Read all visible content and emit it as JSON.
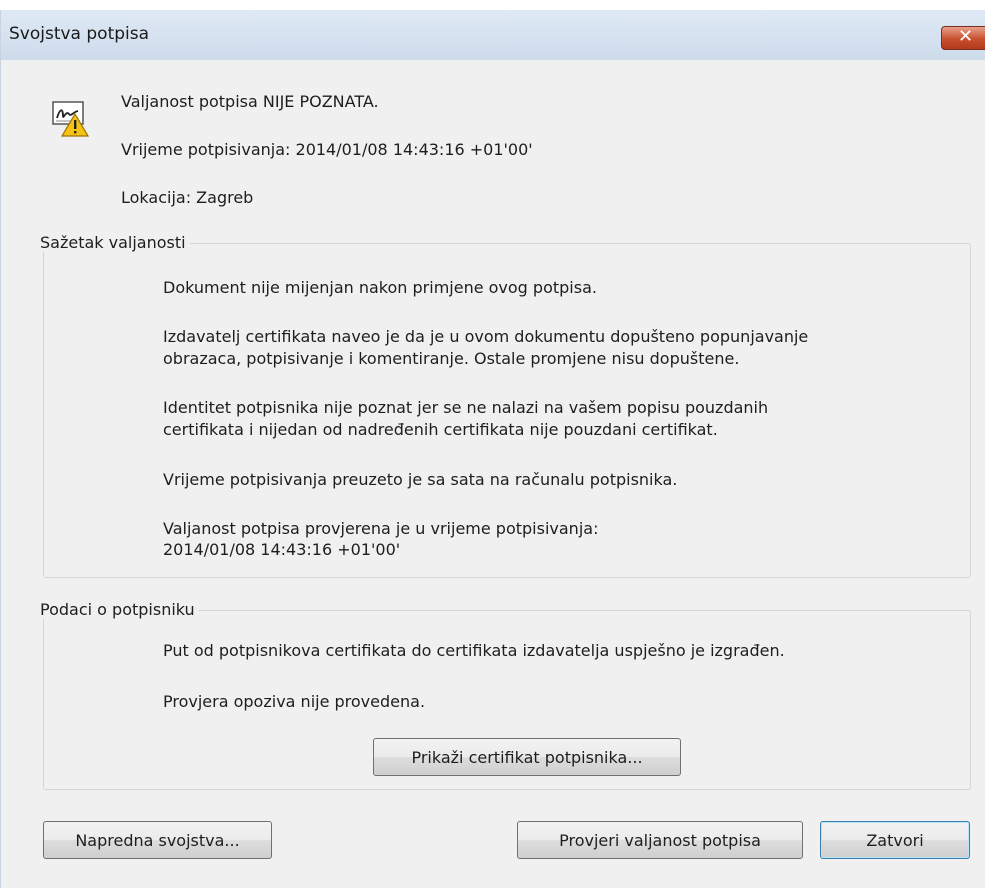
{
  "window": {
    "title": "Svojstva potpisa",
    "close_icon": "close-icon"
  },
  "header": {
    "icon": "signature-warning-icon",
    "status": "Valjanost potpisa NIJE POZNATA.",
    "signing_time": "Vrijeme potpisivanja:  2014/01/08 14:43:16 +01'00'",
    "location": "Lokacija:  Zagreb"
  },
  "validity_summary": {
    "label": "Sažetak valjanosti",
    "lines": [
      "Dokument nije mijenjan nakon primjene ovog potpisa.",
      "Izdavatelj certifikata naveo je da je u ovom dokumentu dopušteno popunjavanje",
      "obrazaca, potpisivanje i komentiranje.  Ostale promjene nisu dopuštene.",
      "Identitet potpisnika nije poznat jer se ne nalazi na vašem popisu pouzdanih",
      "certifikata i nijedan od nadređenih certifikata nije pouzdani certifikat.",
      "Vrijeme potpisivanja preuzeto je sa sata na računalu potpisnika.",
      "Valjanost potpisa provjerena je u vrijeme potpisivanja:",
      "2014/01/08 14:43:16 +01'00'"
    ]
  },
  "signer_info": {
    "label": "Podaci o potpisniku",
    "lines": [
      "Put od potpisnikova certifikata do certifikata izdavatelja uspješno je izgrađen.",
      "Provjera opoziva nije provedena."
    ],
    "show_certificate_button": "Prikaži certifikat potpisnika..."
  },
  "footer": {
    "advanced_button": "Napredna svojstva...",
    "validate_button": "Provjeri valjanost potpisa",
    "close_button": "Zatvori"
  }
}
